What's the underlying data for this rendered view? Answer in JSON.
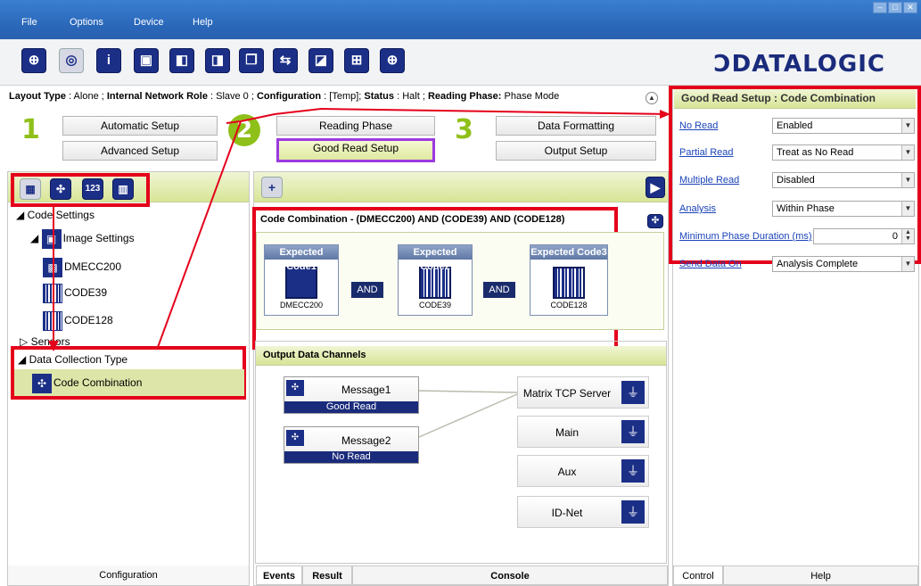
{
  "menu": [
    "File",
    "Options",
    "Device",
    "Help"
  ],
  "window_buttons": [
    "minimize-icon",
    "maximize-icon",
    "close-icon"
  ],
  "toolbar_icons": [
    "crosshair-icon",
    "camera-icon",
    "user-icon",
    "window-icon",
    "device-search-icon",
    "device-save-icon",
    "copy-icon",
    "transfer-icon",
    "device-settings-icon",
    "network-icon",
    "target-icon"
  ],
  "brand": "ƆDATALOGIC",
  "layout": {
    "type_label": "Layout Type",
    "type_value": "Alone",
    "role_label": "Internal Network Role",
    "role_value": "Slave 0",
    "config_label": "Configuration",
    "config_value": "[Temp];",
    "status_label": "Status",
    "status_value": "Halt",
    "phase_label": "Reading Phase:",
    "phase_value": "Phase Mode"
  },
  "steps": {
    "one": "1",
    "two": "2",
    "three": "3",
    "automatic_setup": "Automatic Setup",
    "advanced_setup": "Advanced Setup",
    "reading_phase": "Reading Phase",
    "good_read_setup": "Good Read Setup",
    "data_formatting": "Data Formatting",
    "output_setup": "Output Setup"
  },
  "tree": {
    "code_settings": "Code Settings",
    "image_settings": "Image Settings",
    "dmecc200": "DMECC200",
    "code39": "CODE39",
    "code128": "CODE128",
    "sensors": "Sensors",
    "data_collection_type": "Data Collection Type",
    "code_combination": "Code Combination"
  },
  "left_tab": "Configuration",
  "code_combination": {
    "title": "Code Combination  -  (DMECC200) AND (CODE39) AND (CODE128)",
    "codes": [
      {
        "head": "Expected Code1",
        "label": "DMECC200"
      },
      {
        "head": "Expected Code2",
        "label": "CODE39"
      },
      {
        "head": "Expected Code3",
        "label": "CODE128"
      }
    ],
    "and": "AND"
  },
  "output": {
    "title": "Output Data Channels",
    "messages": [
      {
        "title": "Message1",
        "sub": "Good Read"
      },
      {
        "title": "Message2",
        "sub": "No Read"
      }
    ],
    "channels": [
      "Matrix TCP Server",
      "Main",
      "Aux",
      "ID-Net"
    ]
  },
  "bottom_tabs": {
    "events": "Events",
    "result": "Result",
    "console": "Console"
  },
  "right_panel": {
    "title": "Good Read Setup : Code Combination",
    "fields": [
      {
        "label": "No Read",
        "value": "Enabled"
      },
      {
        "label": "Partial Read",
        "value": "Treat as No Read"
      },
      {
        "label": "Multiple Read",
        "value": "Disabled"
      },
      {
        "label": "Analysis",
        "value": "Within Phase"
      },
      {
        "label": "Minimum Phase Duration (ms)",
        "value": "0"
      },
      {
        "label": "Send Data On",
        "value": "Analysis Complete"
      }
    ],
    "tabs": {
      "control": "Control",
      "help": "Help"
    }
  },
  "colors": {
    "accent_red": "#e4001b",
    "highlight_purple": "#9c39e0",
    "brand_blue": "#1a2b7c",
    "green": "#8fc01a"
  }
}
